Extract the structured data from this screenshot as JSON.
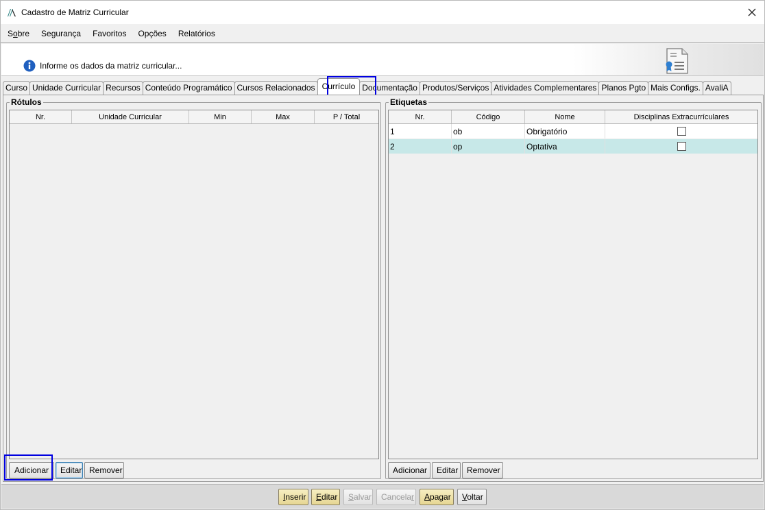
{
  "window": {
    "title": "Cadastro de Matriz Curricular"
  },
  "menu": [
    "Sobre",
    "Segurança",
    "Favoritos",
    "Opções",
    "Relatórios"
  ],
  "banner": {
    "message": "Informe os dados da matriz curricular..."
  },
  "tabs": [
    "Curso",
    "Unidade Curricular",
    "Recursos",
    "Conteúdo Programático",
    "Cursos Relacionados",
    "Currículo",
    "Documentação",
    "Produtos/Serviços",
    "Atividades Complementares",
    "Planos Pgto",
    "Mais Configs.",
    "AvaliA"
  ],
  "active_tab": "Currículo",
  "rotulos": {
    "legend": "Rótulos",
    "columns": [
      "Nr.",
      "Unidade Curricular",
      "Min",
      "Max",
      "P / Total"
    ],
    "rows": [],
    "buttons": {
      "add": "Adicionar",
      "edit": "Editar",
      "remove": "Remover"
    }
  },
  "etiquetas": {
    "legend": "Etiquetas",
    "columns": [
      "Nr.",
      "Código",
      "Nome",
      "Disciplinas Extracurrículares"
    ],
    "rows": [
      {
        "nr": "1",
        "codigo": "ob",
        "nome": "Obrigatório",
        "extracurricular": false
      },
      {
        "nr": "2",
        "codigo": "op",
        "nome": "Optativa",
        "extracurricular": false
      }
    ],
    "buttons": {
      "add": "Adicionar",
      "edit": "Editar",
      "remove": "Remover"
    }
  },
  "footer": {
    "insert": "Inserir",
    "edit": "Editar",
    "save": "Salvar",
    "cancel": "Cancelar",
    "delete": "Apagar",
    "back": "Voltar"
  },
  "colors": {
    "highlight": "#0000e0",
    "selected_row": "#c7e8e8",
    "primary_button": "#e6d693"
  }
}
